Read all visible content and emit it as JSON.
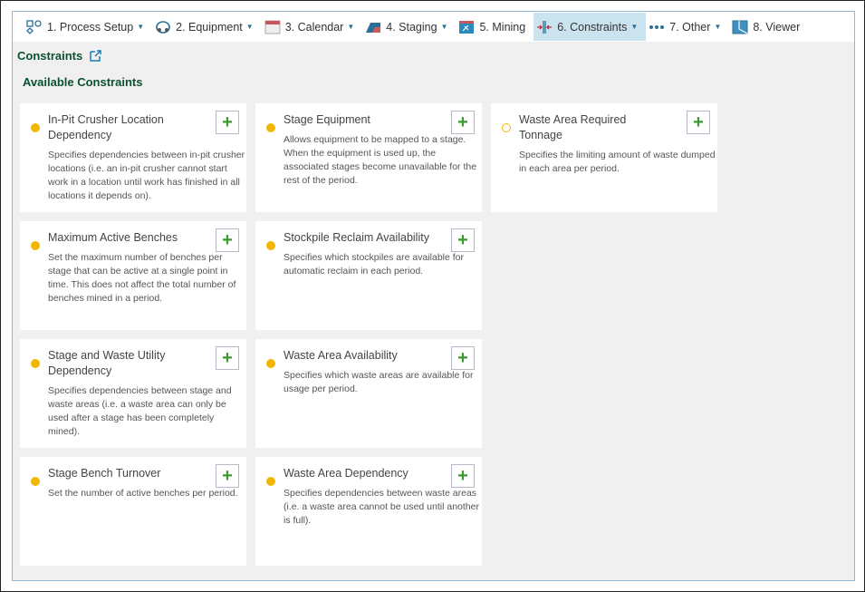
{
  "nav": [
    {
      "label": "1. Process Setup",
      "icon": "process-setup-icon",
      "caret": true
    },
    {
      "label": "2. Equipment",
      "icon": "equipment-icon",
      "caret": true
    },
    {
      "label": "3. Calendar",
      "icon": "calendar-icon",
      "caret": true
    },
    {
      "label": "4. Staging",
      "icon": "staging-icon",
      "caret": true
    },
    {
      "label": "5. Mining",
      "icon": "mining-icon",
      "caret": false
    },
    {
      "label": "6. Constraints",
      "icon": "constraints-icon",
      "caret": true,
      "active": true
    },
    {
      "label": "7. Other",
      "icon": "more-dots-icon",
      "caret": true
    },
    {
      "label": "8. Viewer",
      "icon": "viewer-icon",
      "caret": false
    }
  ],
  "page_title": "Constraints",
  "section_title": "Available Constraints",
  "add_label": "+",
  "colors": {
    "accent": "#0b5130",
    "dot": "#f2b705",
    "plus": "#3a9a2e",
    "active_tab": "#cbe3ee"
  },
  "cards": [
    {
      "title": "In-Pit Crusher Location Dependency",
      "desc": "Specifies dependencies between in-pit crusher locations (i.e. an in-pit crusher cannot start work in a location until work has finished in all locations it depends on).",
      "hollow": false
    },
    {
      "title": "Stage Equipment",
      "desc": "Allows equipment to be mapped to a stage. When the equipment is used up, the associated stages become unavailable for the rest of the period.",
      "hollow": false
    },
    {
      "title": "Waste Area Required Tonnage",
      "desc": "Specifies the limiting amount of waste dumped in each area per period.",
      "hollow": true
    },
    {
      "title": "Maximum Active Benches",
      "desc": "Set the maximum number of benches per stage that can be active at a single point in time. This does not affect the total number of benches mined in a period.",
      "hollow": false
    },
    {
      "title": "Stockpile Reclaim Availability",
      "desc": "Specifies which stockpiles are available for automatic reclaim in each period.",
      "hollow": false
    },
    null,
    {
      "title": "Stage and Waste Utility Dependency",
      "desc": "Specifies dependencies between stage and waste areas (i.e. a waste area can only be used after a stage has been completely mined).",
      "hollow": false
    },
    {
      "title": "Waste Area Availability",
      "desc": "Specifies which waste areas are available for usage per period.",
      "hollow": false
    },
    null,
    {
      "title": "Stage Bench Turnover",
      "desc": "Set the number of active benches per period.",
      "hollow": false
    },
    {
      "title": "Waste Area Dependency",
      "desc": "Specifies dependencies between waste areas (i.e. a waste area cannot be used until another is full).",
      "hollow": false
    }
  ]
}
